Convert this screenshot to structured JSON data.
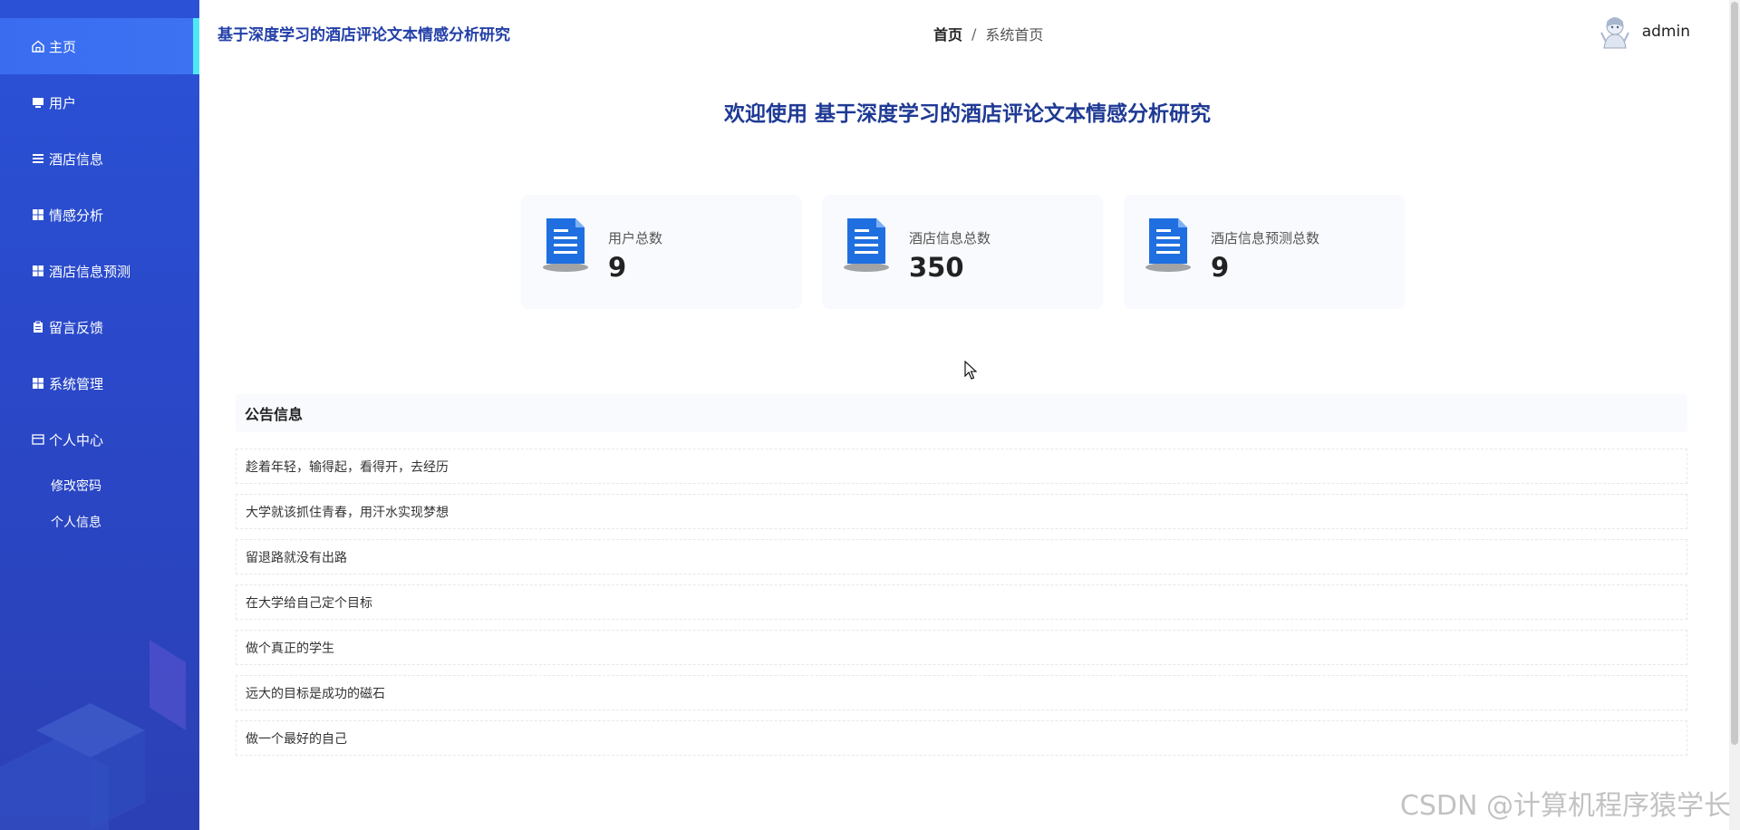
{
  "sidebar": {
    "items": [
      {
        "label": "主页",
        "icon": "home-icon"
      },
      {
        "label": "用户",
        "icon": "monitor-icon"
      },
      {
        "label": "酒店信息",
        "icon": "list-icon"
      },
      {
        "label": "情感分析",
        "icon": "grid-icon"
      },
      {
        "label": "酒店信息预测",
        "icon": "grid-icon"
      },
      {
        "label": "留言反馈",
        "icon": "clipboard-icon"
      },
      {
        "label": "系统管理",
        "icon": "grid-icon"
      },
      {
        "label": "个人中心",
        "icon": "card-icon"
      }
    ],
    "sub_items": [
      {
        "label": "修改密码"
      },
      {
        "label": "个人信息"
      }
    ]
  },
  "header": {
    "app_title": "基于深度学习的酒店评论文本情感分析研究",
    "breadcrumb": {
      "home": "首页",
      "separator": "/",
      "current": "系统首页"
    },
    "username": "admin"
  },
  "main": {
    "welcome": "欢迎使用 基于深度学习的酒店评论文本情感分析研究",
    "stats": [
      {
        "label": "用户总数",
        "value": "9"
      },
      {
        "label": "酒店信息总数",
        "value": "350"
      },
      {
        "label": "酒店信息预测总数",
        "value": "9"
      }
    ],
    "notice_title": "公告信息",
    "notices": [
      "趁着年轻，输得起，看得开，去经历",
      "大学就该抓住青春，用汗水实现梦想",
      "留退路就没有出路",
      "在大学给自己定个目标",
      "做个真正的学生",
      "远大的目标是成功的磁石",
      "做一个最好的自己"
    ]
  },
  "watermark": "CSDN @计算机程序猿学长",
  "colors": {
    "sidebar": "#2a48c9",
    "active": "#3d73f3",
    "accent": "#4fe7f5",
    "title": "#1f3a94"
  }
}
